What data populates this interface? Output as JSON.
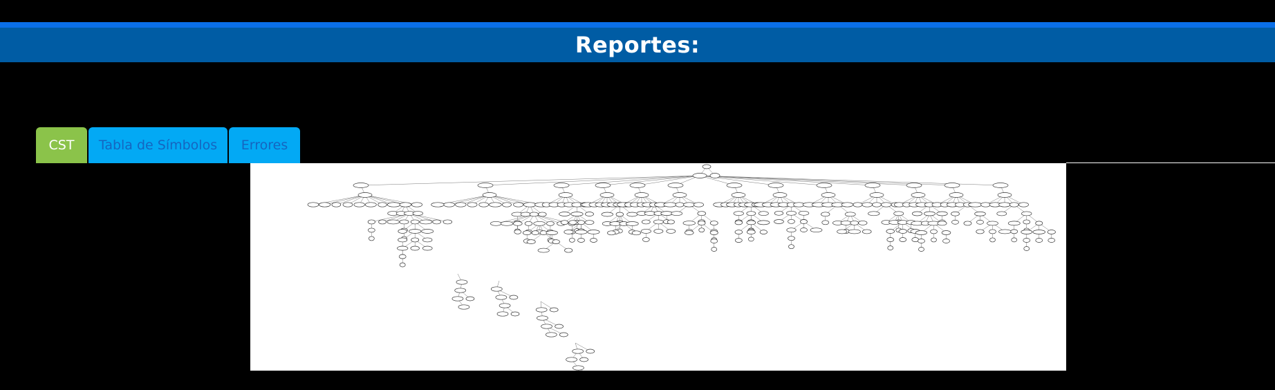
{
  "header": {
    "title": "Reportes:"
  },
  "tabs": [
    {
      "label": "CST",
      "active": true
    },
    {
      "label": "Tabla de Símbolos",
      "active": false
    },
    {
      "label": "Errores",
      "active": false
    }
  ],
  "colors": {
    "accent_strip": "#0a6fe8",
    "header_bg": "#005ca4",
    "tab_active_bg": "#8bc34a",
    "tab_inactive_bg": "#03a9f4",
    "tab_inactive_text": "#1565c0"
  },
  "cst_image": {
    "description": "CST tree graph (Graphviz rendering)"
  }
}
